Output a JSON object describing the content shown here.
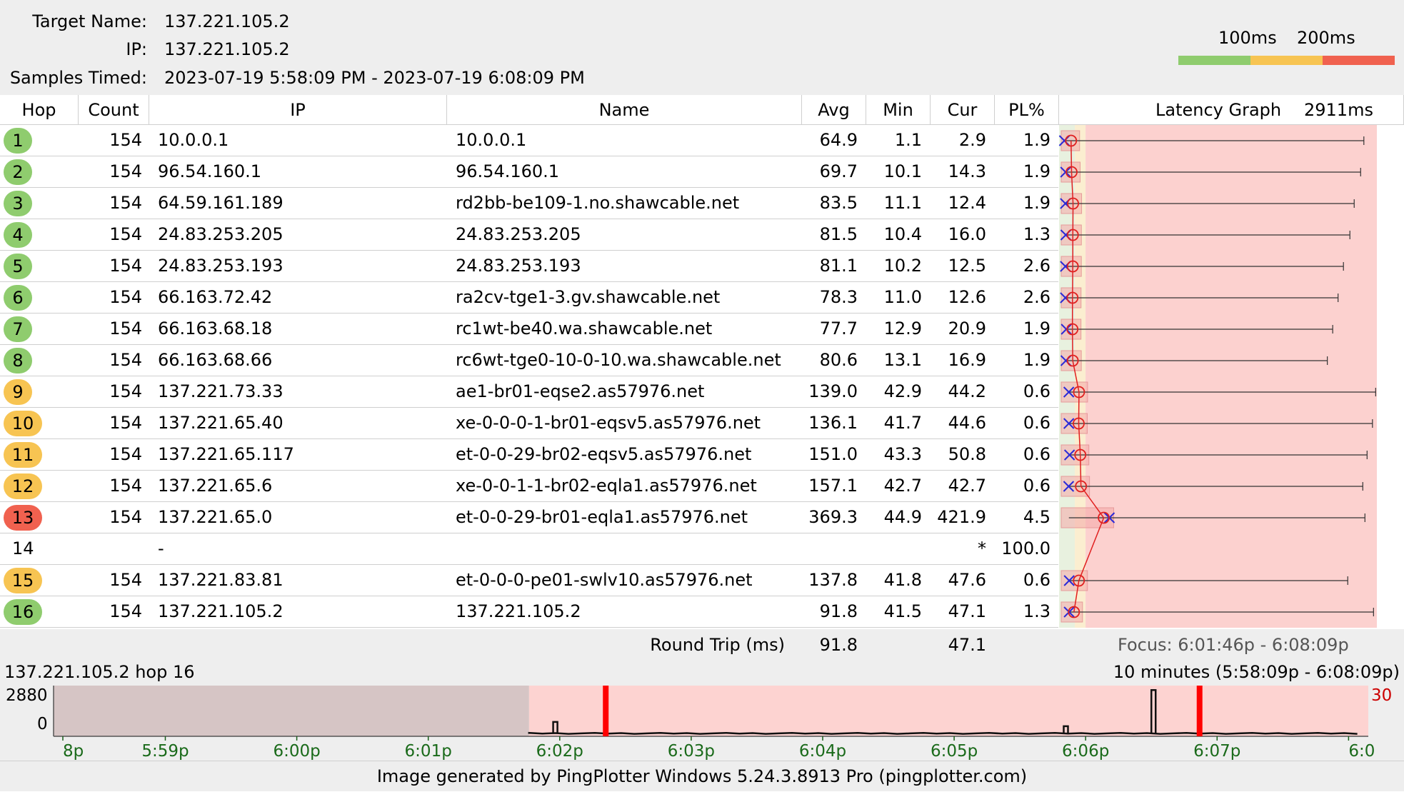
{
  "header": {
    "target_name_label": "Target Name:",
    "target_name": "137.221.105.2",
    "ip_label": "IP:",
    "ip": "137.221.105.2",
    "samples_label": "Samples Timed:",
    "samples": "2023-07-19 5:58:09 PM - 2023-07-19 6:08:09 PM",
    "legend_100": "100ms",
    "legend_200": "200ms",
    "legend_colors": {
      "good": "#8fcc6e",
      "warn": "#f7c452",
      "bad": "#f0614f"
    }
  },
  "columns": {
    "hop": "Hop",
    "count": "Count",
    "ip": "IP",
    "name": "Name",
    "avg": "Avg",
    "min": "Min",
    "cur": "Cur",
    "pl": "PL%",
    "graph": "Latency Graph",
    "graph_max": "2911ms"
  },
  "rows": [
    {
      "hop": "1",
      "status": "good",
      "count": "154",
      "ip": "10.0.0.1",
      "name": "10.0.0.1",
      "avg": "64.9",
      "min": "1.1",
      "cur": "2.9",
      "pl": "1.9",
      "avg_ms": 64.9,
      "min_ms": 1.1,
      "cur_ms": 2.9,
      "max_ms": 2790
    },
    {
      "hop": "2",
      "status": "good",
      "count": "154",
      "ip": "96.54.160.1",
      "name": "96.54.160.1",
      "avg": "69.7",
      "min": "10.1",
      "cur": "14.3",
      "pl": "1.9",
      "avg_ms": 69.7,
      "min_ms": 10.1,
      "cur_ms": 14.3,
      "max_ms": 2760
    },
    {
      "hop": "3",
      "status": "good",
      "count": "154",
      "ip": "64.59.161.189",
      "name": "rd2bb-be109-1.no.shawcable.net",
      "avg": "83.5",
      "min": "11.1",
      "cur": "12.4",
      "pl": "1.9",
      "avg_ms": 83.5,
      "min_ms": 11.1,
      "cur_ms": 12.4,
      "max_ms": 2700
    },
    {
      "hop": "4",
      "status": "good",
      "count": "154",
      "ip": "24.83.253.205",
      "name": "24.83.253.205",
      "avg": "81.5",
      "min": "10.4",
      "cur": "16.0",
      "pl": "1.3",
      "avg_ms": 81.5,
      "min_ms": 10.4,
      "cur_ms": 16.0,
      "max_ms": 2660
    },
    {
      "hop": "5",
      "status": "good",
      "count": "154",
      "ip": "24.83.253.193",
      "name": "24.83.253.193",
      "avg": "81.1",
      "min": "10.2",
      "cur": "12.5",
      "pl": "2.6",
      "avg_ms": 81.1,
      "min_ms": 10.2,
      "cur_ms": 12.5,
      "max_ms": 2600
    },
    {
      "hop": "6",
      "status": "good",
      "count": "154",
      "ip": "66.163.72.42",
      "name": "ra2cv-tge1-3.gv.shawcable.net",
      "avg": "78.3",
      "min": "11.0",
      "cur": "12.6",
      "pl": "2.6",
      "avg_ms": 78.3,
      "min_ms": 11.0,
      "cur_ms": 12.6,
      "max_ms": 2550
    },
    {
      "hop": "7",
      "status": "good",
      "count": "154",
      "ip": "66.163.68.18",
      "name": "rc1wt-be40.wa.shawcable.net",
      "avg": "77.7",
      "min": "12.9",
      "cur": "20.9",
      "pl": "1.9",
      "avg_ms": 77.7,
      "min_ms": 12.9,
      "cur_ms": 20.9,
      "max_ms": 2500
    },
    {
      "hop": "8",
      "status": "good",
      "count": "154",
      "ip": "66.163.68.66",
      "name": "rc6wt-tge0-10-0-10.wa.shawcable.net",
      "avg": "80.6",
      "min": "13.1",
      "cur": "16.9",
      "pl": "1.9",
      "avg_ms": 80.6,
      "min_ms": 13.1,
      "cur_ms": 16.9,
      "max_ms": 2450
    },
    {
      "hop": "9",
      "status": "warn",
      "count": "154",
      "ip": "137.221.73.33",
      "name": "ae1-br01-eqse2.as57976.net",
      "avg": "139.0",
      "min": "42.9",
      "cur": "44.2",
      "pl": "0.6",
      "avg_ms": 139.0,
      "min_ms": 42.9,
      "cur_ms": 44.2,
      "max_ms": 2900
    },
    {
      "hop": "10",
      "status": "warn",
      "count": "154",
      "ip": "137.221.65.40",
      "name": "xe-0-0-0-1-br01-eqsv5.as57976.net",
      "avg": "136.1",
      "min": "41.7",
      "cur": "44.6",
      "pl": "0.6",
      "avg_ms": 136.1,
      "min_ms": 41.7,
      "cur_ms": 44.6,
      "max_ms": 2870
    },
    {
      "hop": "11",
      "status": "warn",
      "count": "154",
      "ip": "137.221.65.117",
      "name": "et-0-0-29-br02-eqsv5.as57976.net",
      "avg": "151.0",
      "min": "43.3",
      "cur": "50.8",
      "pl": "0.6",
      "avg_ms": 151.0,
      "min_ms": 43.3,
      "cur_ms": 50.8,
      "max_ms": 2820
    },
    {
      "hop": "12",
      "status": "warn",
      "count": "154",
      "ip": "137.221.65.6",
      "name": "xe-0-0-1-1-br02-eqla1.as57976.net",
      "avg": "157.1",
      "min": "42.7",
      "cur": "42.7",
      "pl": "0.6",
      "avg_ms": 157.1,
      "min_ms": 42.7,
      "cur_ms": 42.7,
      "max_ms": 2780
    },
    {
      "hop": "13",
      "status": "bad",
      "count": "154",
      "ip": "137.221.65.0",
      "name": "et-0-0-29-br01-eqla1.as57976.net",
      "avg": "369.3",
      "min": "44.9",
      "cur": "421.9",
      "pl": "4.5",
      "avg_ms": 369.3,
      "min_ms": 44.9,
      "cur_ms": 421.9,
      "max_ms": 2800
    },
    {
      "hop": "14",
      "status": "none",
      "count": "",
      "ip": "-",
      "name": "",
      "avg": "",
      "min": "",
      "cur": "*",
      "pl": "100.0",
      "avg_ms": null,
      "min_ms": null,
      "cur_ms": null,
      "max_ms": null
    },
    {
      "hop": "15",
      "status": "warn",
      "count": "154",
      "ip": "137.221.83.81",
      "name": "et-0-0-0-pe01-swlv10.as57976.net",
      "avg": "137.8",
      "min": "41.8",
      "cur": "47.6",
      "pl": "0.6",
      "avg_ms": 137.8,
      "min_ms": 41.8,
      "cur_ms": 47.6,
      "max_ms": 2640
    },
    {
      "hop": "16",
      "status": "good",
      "count": "154",
      "ip": "137.221.105.2",
      "name": "137.221.105.2",
      "avg": "91.8",
      "min": "41.5",
      "cur": "47.1",
      "pl": "1.3",
      "avg_ms": 91.8,
      "min_ms": 41.5,
      "cur_ms": 47.1,
      "max_ms": 2880
    }
  ],
  "footer": {
    "round_trip_label": "Round Trip (ms)",
    "round_trip_avg": "91.8",
    "round_trip_cur": "47.1",
    "focus": "Focus: 6:01:46p - 6:08:09p"
  },
  "history": {
    "target": "137.221.105.2 hop 16",
    "range": "10 minutes (5:58:09p - 6:08:09p)",
    "y_max": "2880",
    "y_min": "0",
    "right_value": "30",
    "ticks": [
      "8p",
      "5:59p",
      "6:00p",
      "6:01p",
      "6:02p",
      "6:03p",
      "6:04p",
      "6:05p",
      "6:06p",
      "6:07p",
      "6:0"
    ],
    "spikes": [
      {
        "time": "6:01:57p",
        "value": 780
      },
      {
        "time": "6:05:50p",
        "value": 520
      },
      {
        "time": "6:06:30p",
        "value": 2700
      }
    ],
    "loss_events": [
      "6:02:21p",
      "6:06:52p"
    ]
  },
  "image_note": "Image generated by PingPlotter Windows 5.24.3.8913 Pro (pingplotter.com)"
}
